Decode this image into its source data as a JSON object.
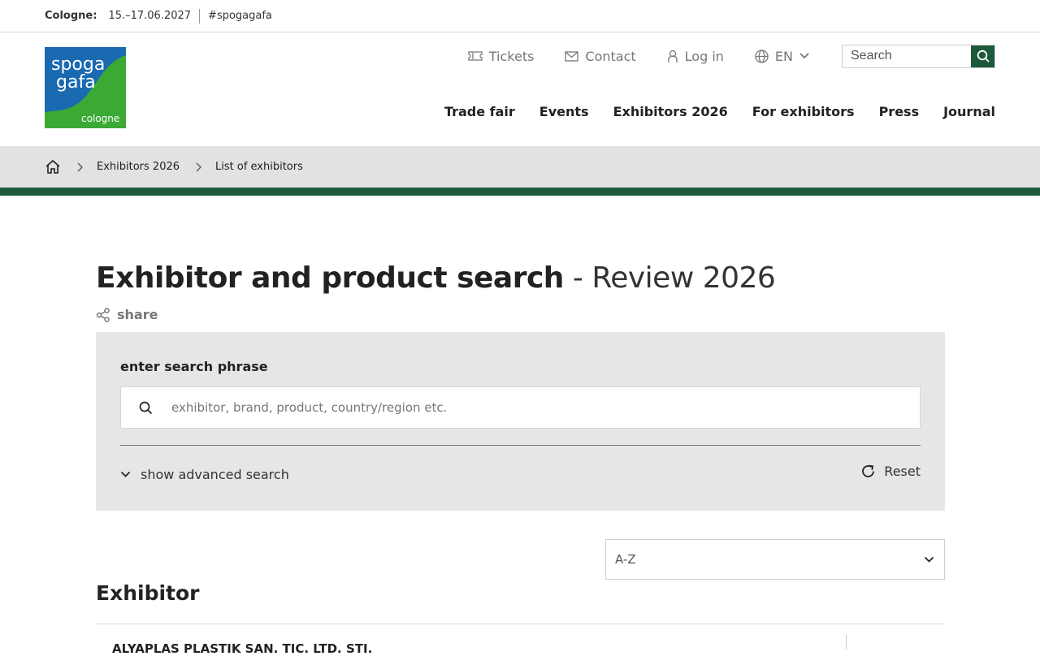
{
  "topbar": {
    "city_label": "Cologne:",
    "dates": "15.–17.06.2027",
    "hashtag": "#spogagafa"
  },
  "logo": {
    "line1": "spoga",
    "line2": "gafa",
    "sub": "cologne",
    "colors": {
      "blue": "#1a6ab1",
      "green": "#3aaa35"
    }
  },
  "utility": {
    "tickets": "Tickets",
    "contact": "Contact",
    "login": "Log in",
    "language": "EN",
    "search_placeholder": "Search"
  },
  "main_nav": [
    "Trade fair",
    "Events",
    "Exhibitors 2026",
    "For exhibitors",
    "Press",
    "Journal"
  ],
  "breadcrumb": {
    "home_icon": "home-icon",
    "items": [
      "Exhibitors 2026",
      "List of exhibitors"
    ]
  },
  "page": {
    "title_main": "Exhibitor and product search",
    "title_suffix": " - Review 2026",
    "share": "share"
  },
  "search_panel": {
    "label": "enter search phrase",
    "placeholder": "exhibitor, brand, product, country/region etc.",
    "advanced_toggle": "show advanced search",
    "reset": "Reset"
  },
  "sort": {
    "selected": "A-Z"
  },
  "results": {
    "section_title": "Exhibitor",
    "first_row": "ALYAPLAS PLASTIK SAN. TIC. LTD. STI."
  },
  "colors": {
    "accent": "#1d5a3c",
    "panel": "#e6e6e6",
    "breadcrumb_bg": "#e2e2e2"
  }
}
